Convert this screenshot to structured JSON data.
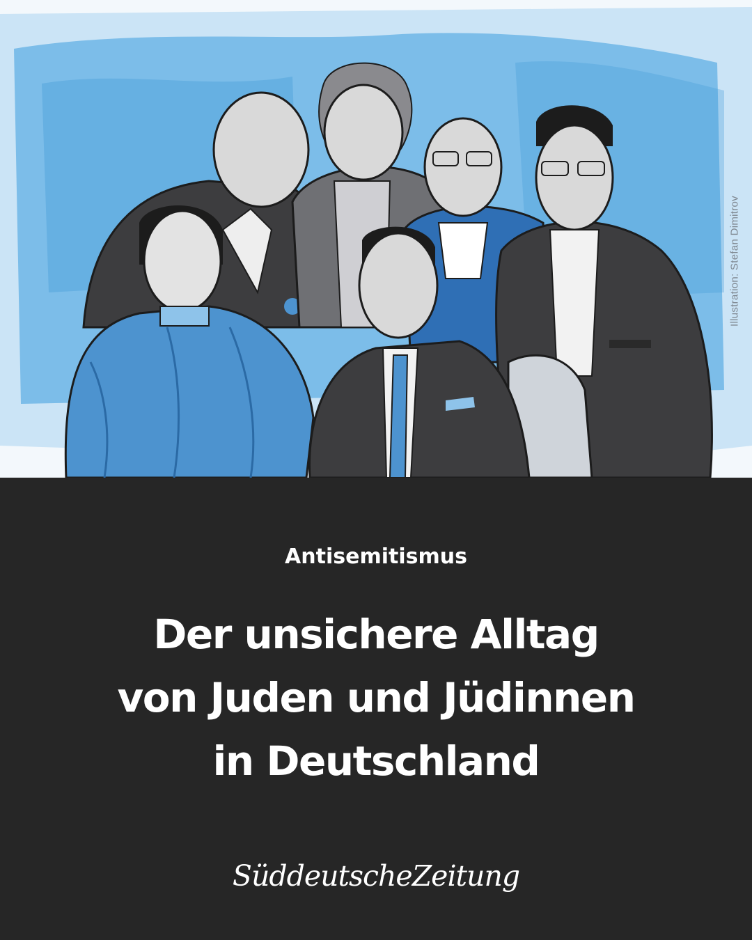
{
  "illustration": {
    "credit": "Illustration: Stefan Dimitrov",
    "colors": {
      "wash": "#62b0e4",
      "wash_light": "#a9d3f0",
      "ink": "#1c1c1c",
      "jacket_dark": "#3d3d3f",
      "jacket_grey": "#6f7074",
      "skin": "#d9d9d9",
      "blue_fabric": "#4d93cf"
    },
    "figures": [
      "woman-left-blue-blouse",
      "older-man-back-left",
      "woman-back-center",
      "bald-man-glasses-back-right",
      "man-glasses-right",
      "man-seated-front-center"
    ]
  },
  "kicker": "Antisemitismus",
  "headline": {
    "line1": "Der unsichere Alltag",
    "line2": "von Juden und Jüdinnen",
    "line3": "in Deutschland"
  },
  "brand": {
    "name": "SüddeutscheZeitung"
  },
  "colors": {
    "panel_bg": "#262626",
    "text": "#ffffff"
  }
}
